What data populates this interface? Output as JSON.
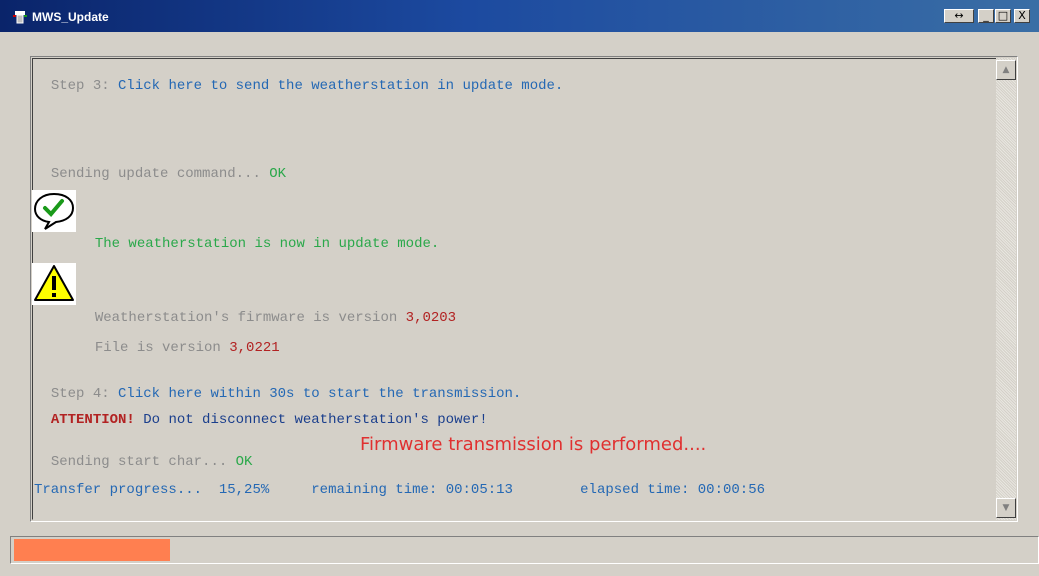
{
  "window": {
    "title": "MWS_Update",
    "controls": [
      "↔",
      "_",
      "□",
      "X"
    ]
  },
  "log": {
    "step3_prefix": "Step 3:",
    "step3_link": "Click here to send the weatherstation in update mode.",
    "sending_update": "Sending update command...",
    "ok1": "OK",
    "update_mode_msg": "The weatherstation is now in update mode.",
    "fw_label": "Weatherstation's firmware is version",
    "fw_version": "3,0203",
    "file_label": "File is version",
    "file_version": "3,0221",
    "step4_prefix": "Step 4:",
    "step4_link": "Click here within 30s to start the transmission.",
    "attention_label": "ATTENTION!",
    "attention_msg": "Do not disconnect weatherstation's power!",
    "sending_start": "Sending start char...",
    "ok2": "OK",
    "performed_msg": "Firmware transmission is performed....",
    "transfer_label": "Transfer progress...",
    "transfer_percent": "15,25%",
    "remaining_label": "remaining time:",
    "remaining_value": "00:05:13",
    "elapsed_label": "elapsed time:",
    "elapsed_value": "00:00:56"
  },
  "progress": {
    "fraction": 0.1525,
    "color": "#ff7f50"
  },
  "icons": {
    "success": "checkmark-speech-bubble-icon",
    "warning": "warning-triangle-icon"
  }
}
